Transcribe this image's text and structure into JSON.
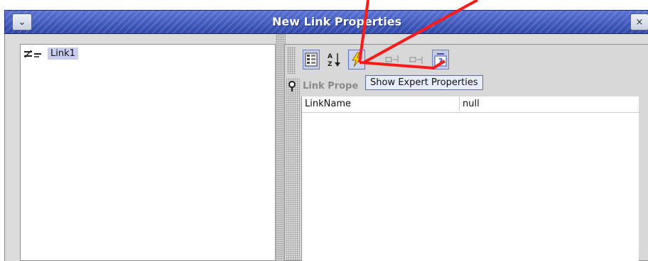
{
  "window": {
    "title": "New Link Properties",
    "menu_glyph": "⌄",
    "close_glyph": "×"
  },
  "tree": {
    "items": [
      {
        "label": "Link1",
        "icon": "link-icon",
        "selected": true
      }
    ]
  },
  "toolbar": {
    "buttons": [
      {
        "name": "categorized-view-icon",
        "state": "pressed"
      },
      {
        "name": "sort-alphabetical-icon",
        "state": "normal"
      },
      {
        "name": "expert-properties-icon",
        "state": "hover"
      },
      {
        "name": "move-up-icon",
        "state": "disabled"
      },
      {
        "name": "move-down-icon",
        "state": "disabled"
      },
      {
        "name": "help-icon",
        "state": "pressed"
      }
    ],
    "tooltip": "Show Expert Properties"
  },
  "properties": {
    "section_title": "Link Prope",
    "rows": [
      {
        "name": "LinkName",
        "value": "null"
      }
    ]
  },
  "colors": {
    "title_bar": "#3d55b8",
    "selection": "#c8cdf0",
    "annotation_arrow": "#ff0000"
  }
}
